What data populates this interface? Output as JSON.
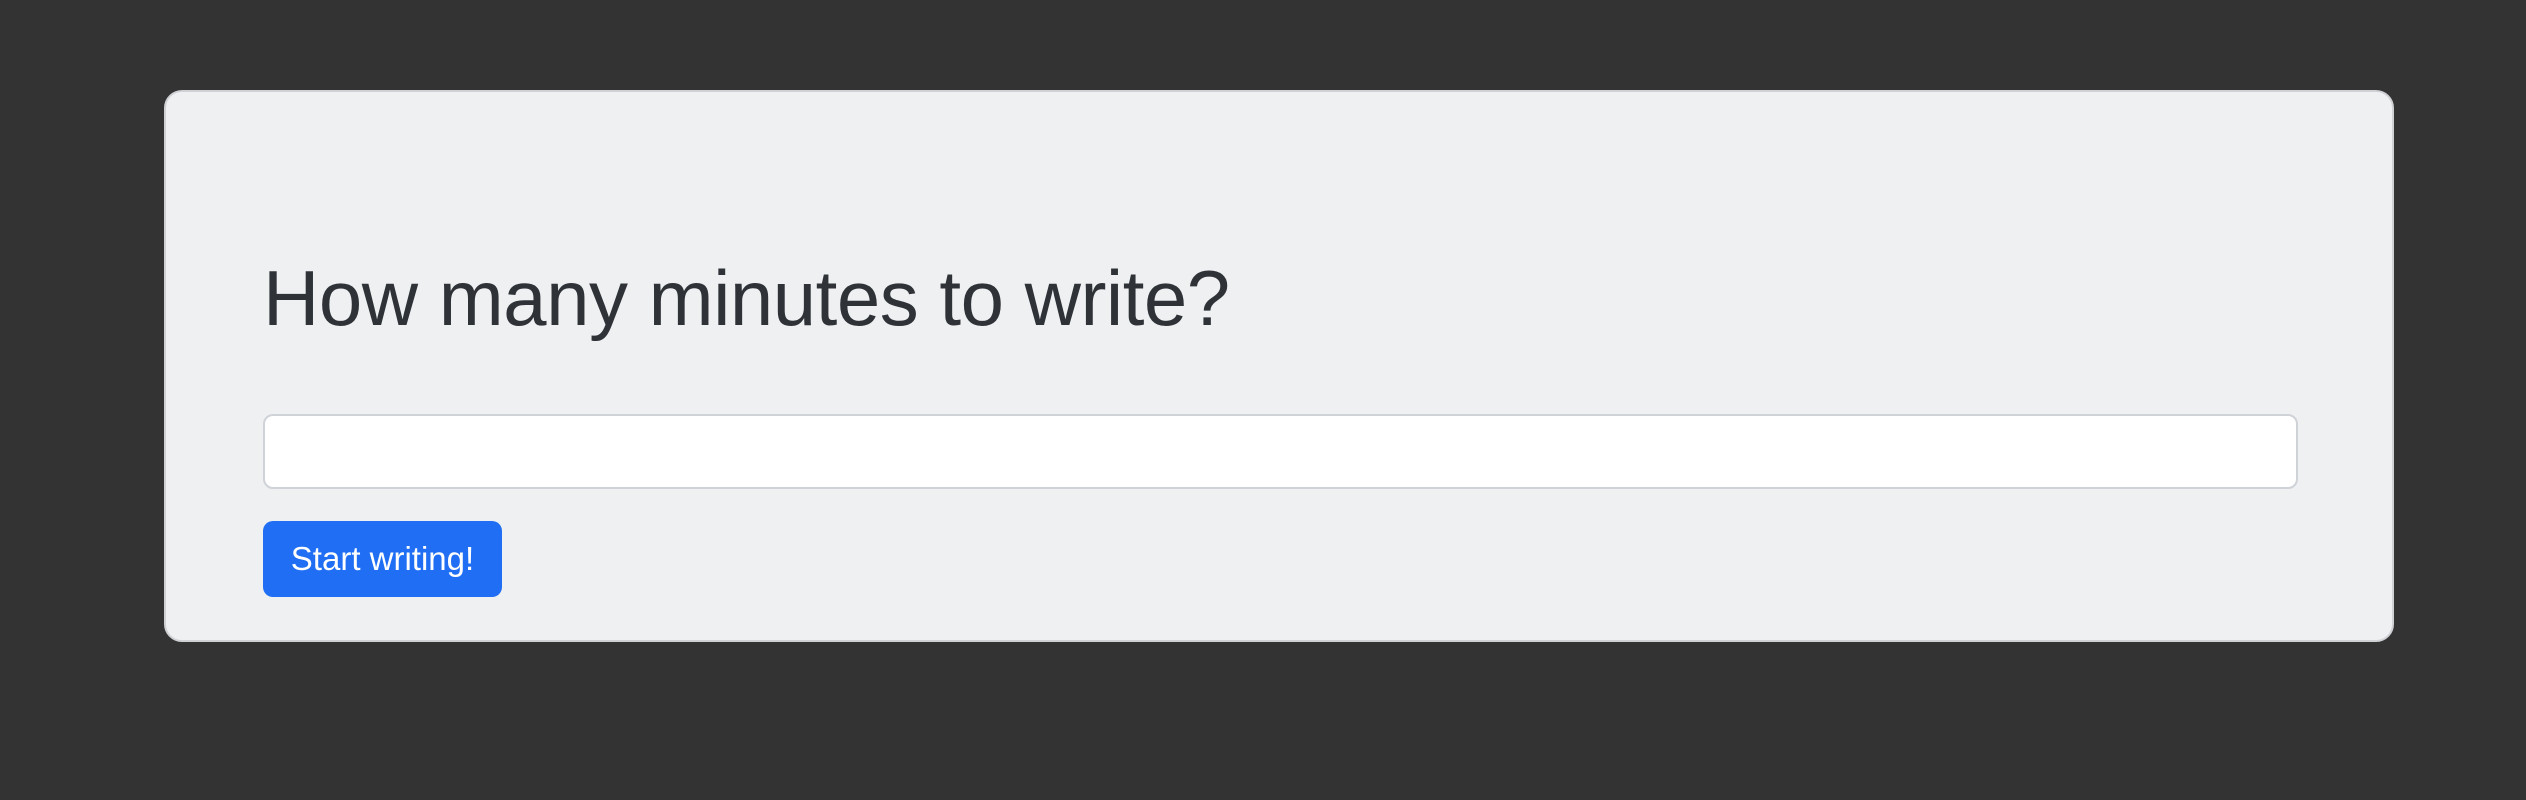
{
  "page": {
    "background_color": "#333333"
  },
  "card": {
    "title": "How many minutes to write?",
    "minutes_input": {
      "value": "",
      "placeholder": ""
    },
    "start_button_label": "Start writing!",
    "accent_color": "#1f6ef3"
  }
}
